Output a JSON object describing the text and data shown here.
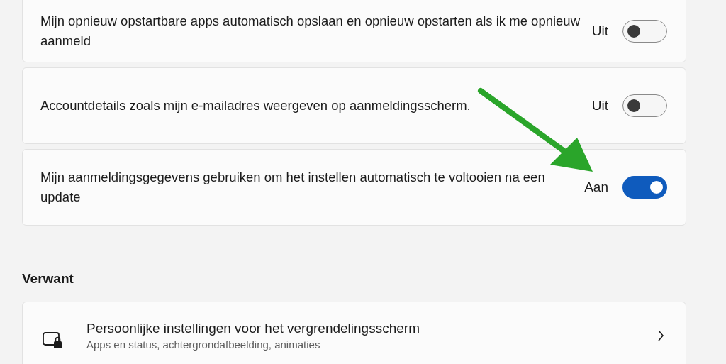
{
  "settings": [
    {
      "label": "Mijn opnieuw opstartbare apps automatisch opslaan en opnieuw opstarten als ik me opnieuw aanmeld",
      "state_text": "Uit",
      "on": false
    },
    {
      "label": "Accountdetails zoals mijn e-mailadres weergeven op aanmeldingsscherm.",
      "state_text": "Uit",
      "on": false
    },
    {
      "label": "Mijn aanmeldingsgegevens gebruiken om het instellen automatisch te voltooien na een update",
      "state_text": "Aan",
      "on": true
    }
  ],
  "related": {
    "heading": "Verwant",
    "items": [
      {
        "title": "Persoonlijke instellingen voor het vergrendelingsscherm",
        "subtitle": "Apps en status, achtergrondafbeelding, animaties"
      }
    ]
  }
}
